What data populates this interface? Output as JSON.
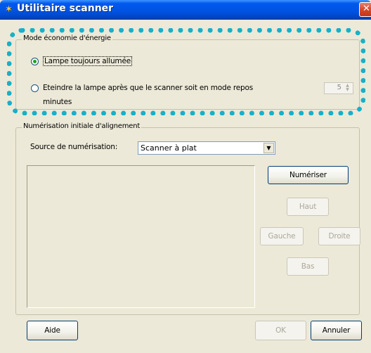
{
  "window": {
    "title": "Utilitaire scanner",
    "icon": "scanner-app-icon",
    "close_glyph": "✕"
  },
  "power_saving": {
    "group_label": "Mode économie d'énergie",
    "option_always_on": "Lampe toujours allumée",
    "option_off_line1": "Eteindre la lampe après que le scanner soit en mode repos",
    "option_off_line2": "minutes",
    "minutes_value": "5",
    "selected": "always_on"
  },
  "alignment": {
    "group_label": "Numérisation initiale d'alignement",
    "source_label": "Source de numérisation:",
    "source_value": "Scanner à plat",
    "scan_button": "Numériser",
    "up_button": "Haut",
    "left_button": "Gauche",
    "right_button": "Droite",
    "down_button": "Bas"
  },
  "footer": {
    "help_button": "Aide",
    "ok_button": "OK",
    "cancel_button": "Annuler"
  },
  "colors": {
    "highlight_dots": "#18b0c8",
    "titlebar": "#0054e3",
    "dialog_bg": "#ece9d8"
  }
}
